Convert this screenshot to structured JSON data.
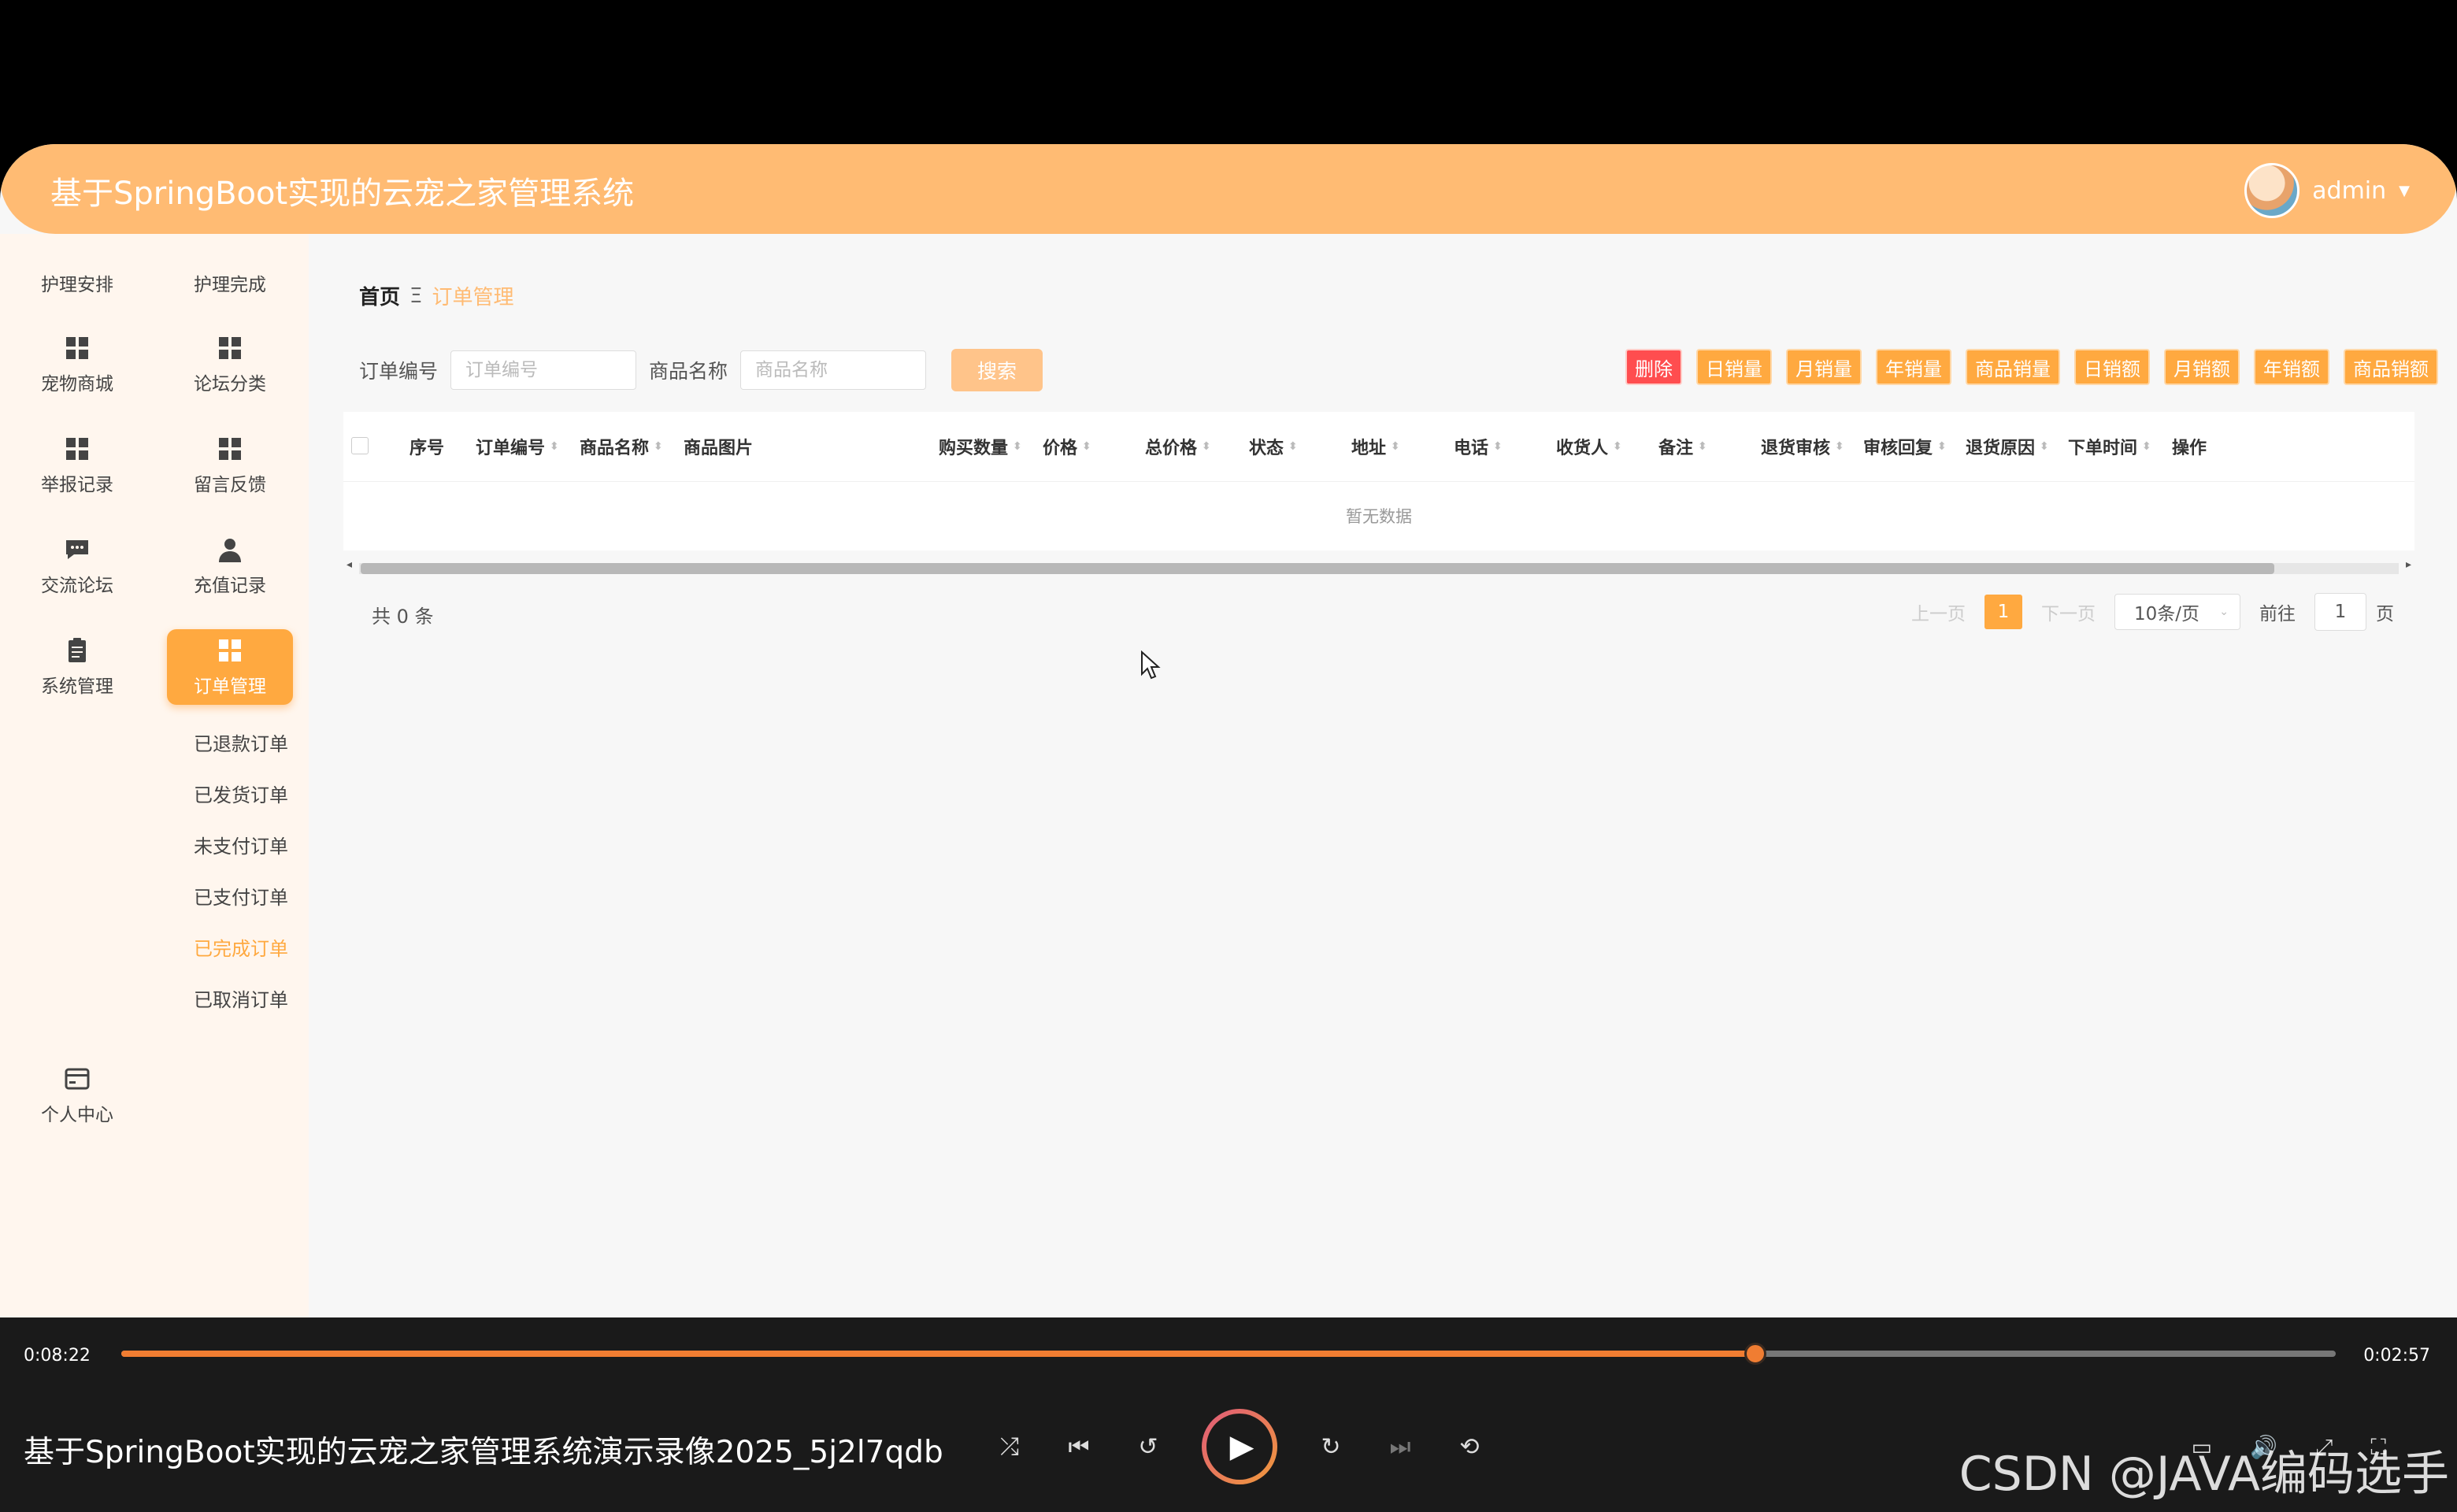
{
  "app": {
    "title": "基于SpringBoot实现的云宠之家管理系统",
    "username": "admin",
    "accent_color": "#ffbb73",
    "active_color": "#ffa940"
  },
  "sidebar": {
    "items": [
      {
        "label": "护理安排",
        "icon": "none"
      },
      {
        "label": "护理完成",
        "icon": "none"
      },
      {
        "label": "宠物商城",
        "icon": "grid-icon"
      },
      {
        "label": "论坛分类",
        "icon": "grid-icon"
      },
      {
        "label": "举报记录",
        "icon": "grid-icon"
      },
      {
        "label": "留言反馈",
        "icon": "grid-icon"
      },
      {
        "label": "交流论坛",
        "icon": "chat-icon"
      },
      {
        "label": "充值记录",
        "icon": "user-icon"
      },
      {
        "label": "系统管理",
        "icon": "clipboard-icon"
      },
      {
        "label": "订单管理",
        "icon": "grid-icon"
      },
      {
        "label": "个人中心",
        "icon": "card-icon"
      }
    ],
    "sub_items": [
      "已退款订单",
      "已发货订单",
      "未支付订单",
      "已支付订单",
      "已完成订单",
      "已取消订单"
    ],
    "active_sub": "已完成订单"
  },
  "breadcrumb": {
    "home": "首页",
    "separator": "Ξ",
    "current": "订单管理"
  },
  "filters": {
    "order_no_label": "订单编号",
    "order_no_placeholder": "订单编号",
    "product_name_label": "商品名称",
    "product_name_placeholder": "商品名称",
    "search_button": "搜索"
  },
  "actions": [
    "删除",
    "日销量",
    "月销量",
    "年销量",
    "商品销量",
    "日销额",
    "月销额",
    "年销额",
    "商品销额"
  ],
  "table": {
    "columns": [
      "序号",
      "订单编号",
      "商品名称",
      "商品图片",
      "购买数量",
      "价格",
      "总价格",
      "状态",
      "地址",
      "电话",
      "收货人",
      "备注",
      "退货审核",
      "审核回复",
      "退货原因",
      "下单时间",
      "操作"
    ],
    "empty_text": "暂无数据"
  },
  "pagination": {
    "total": "共 0 条",
    "prev": "上一页",
    "current_page": "1",
    "next": "下一页",
    "page_size": "10条/页",
    "goto_label": "前往",
    "goto_value": "1",
    "page_suffix": "页"
  },
  "player": {
    "current_time": "0:08:22",
    "total_time": "0:02:57",
    "progress": 0.738,
    "video_title": "基于SpringBoot实现的云宠之家管理系统演示录像2025_5j2l7qdb",
    "watermark": "CSDN @JAVA编码选手",
    "progress_color": "#f07d32"
  }
}
